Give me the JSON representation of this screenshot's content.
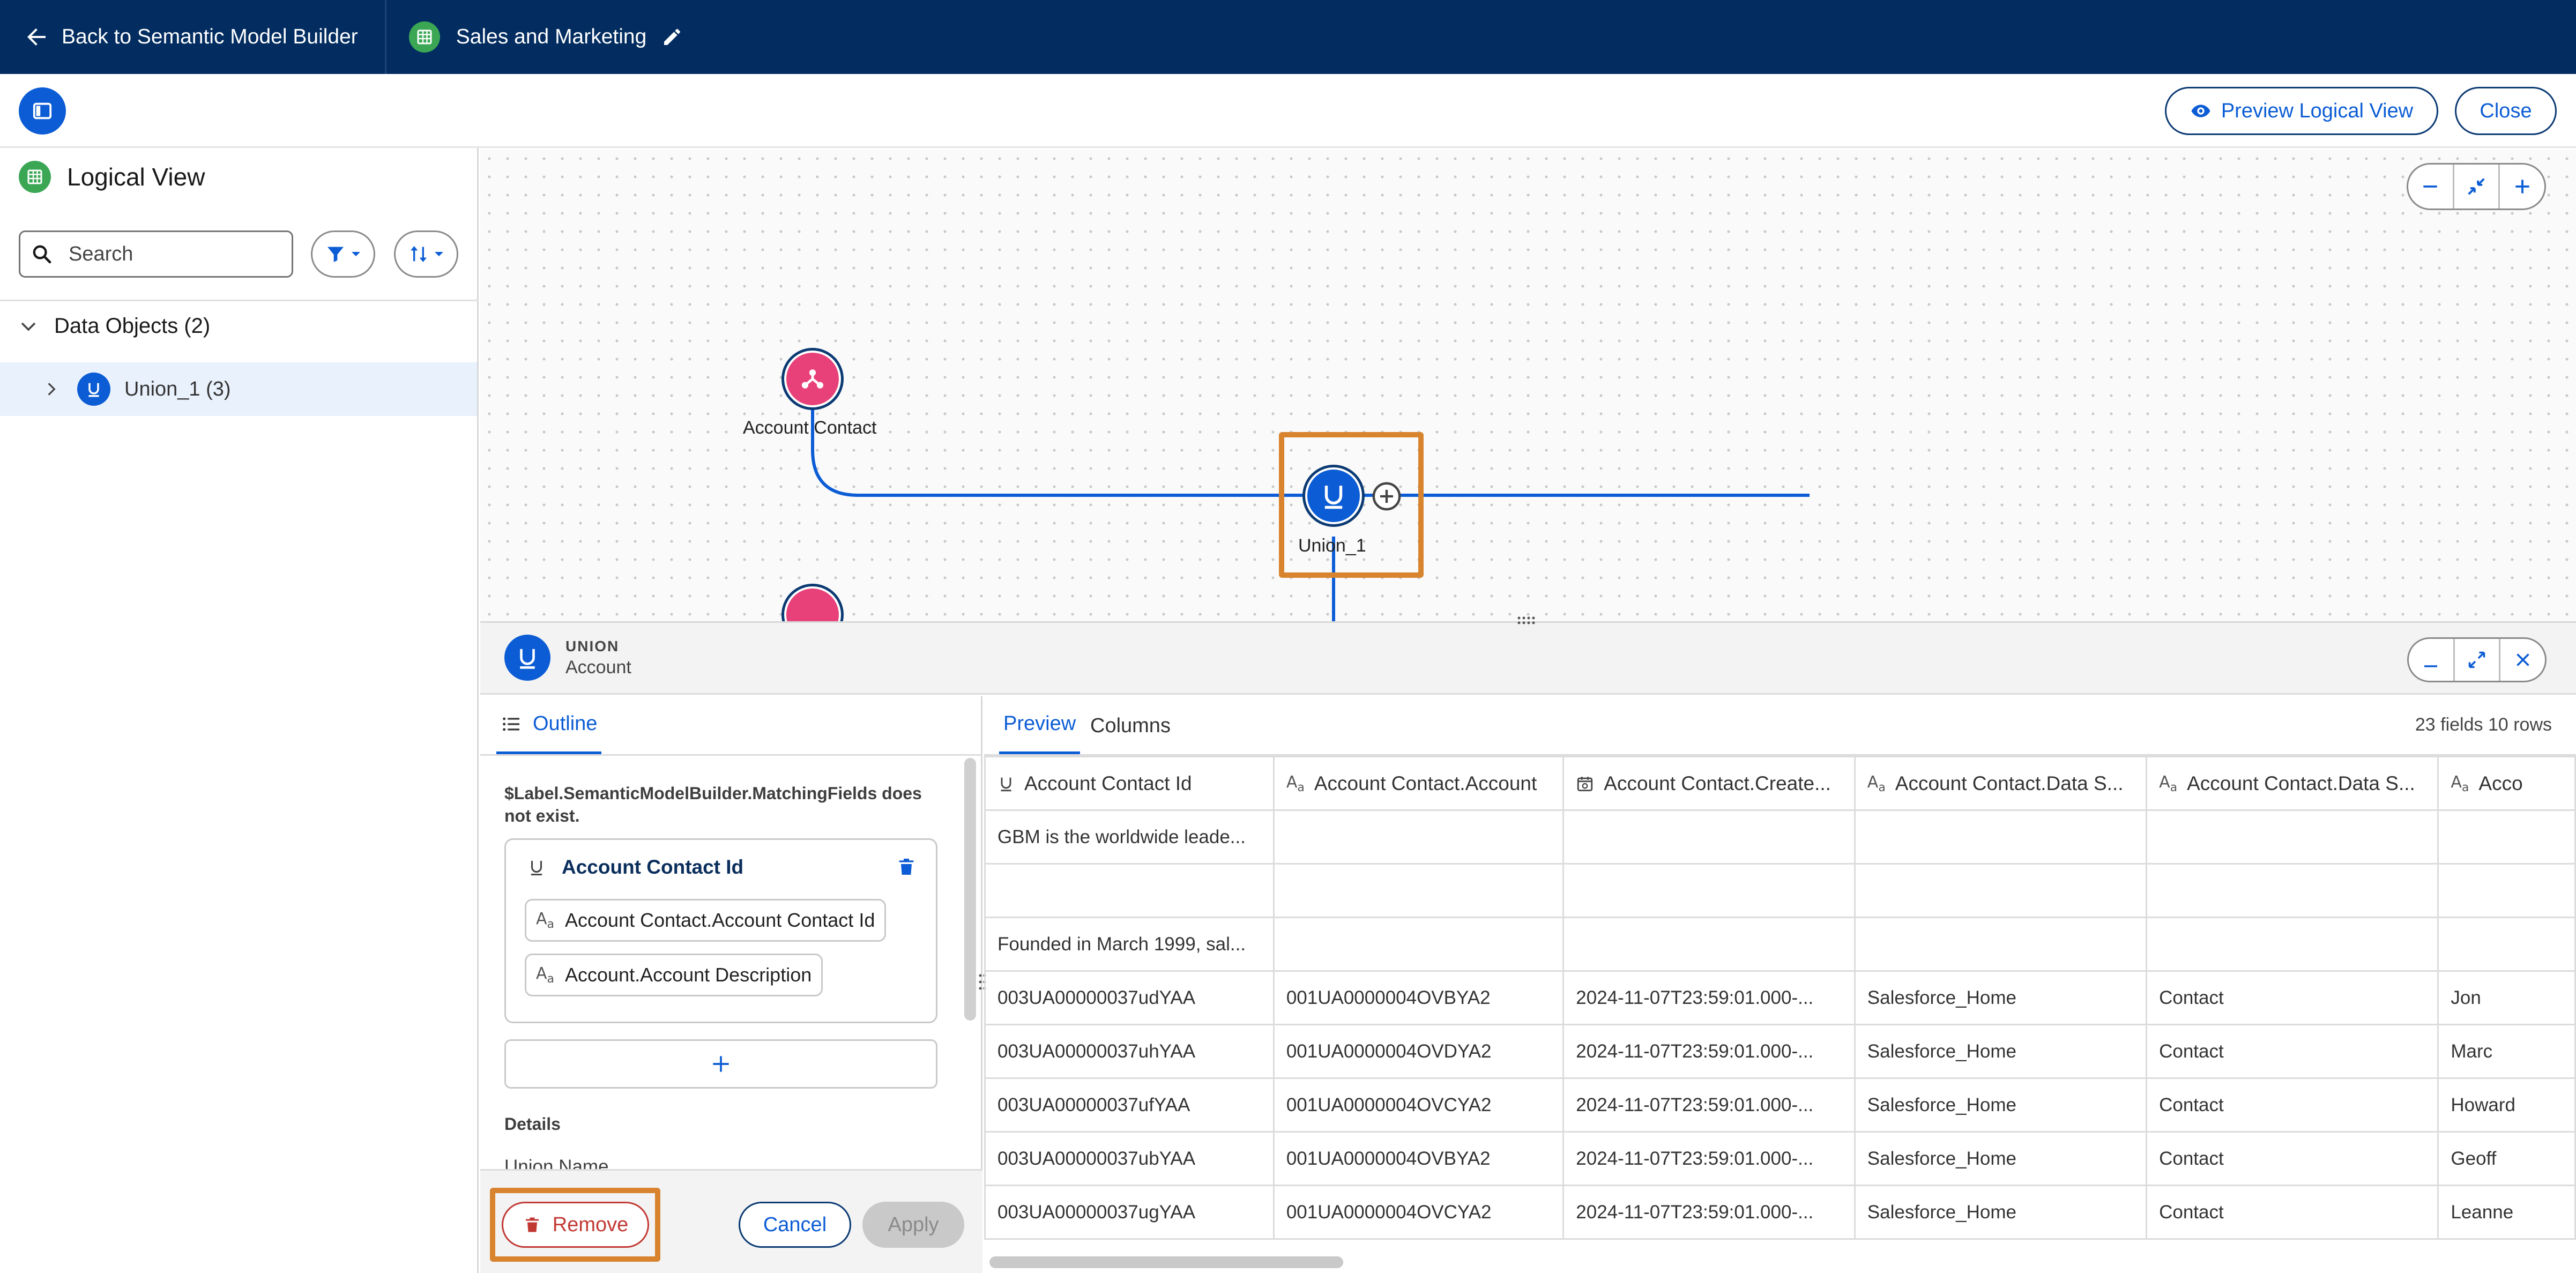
{
  "topbar": {
    "back_label": "Back to Semantic Model Builder",
    "model_name": "Sales and Marketing"
  },
  "header": {
    "preview_label": "Preview Logical View",
    "close_label": "Close"
  },
  "left_panel": {
    "title": "Logical View",
    "search_placeholder": "Search",
    "tree_header": "Data Objects (2)",
    "tree_item": "Union_1 (3)"
  },
  "canvas": {
    "nodes": [
      {
        "label": "Account Contact"
      },
      {
        "label": "Union_1"
      }
    ]
  },
  "bottom_panel": {
    "type_label": "UNION",
    "object_name": "Account"
  },
  "outline": {
    "tab_label": "Outline",
    "warning": "$Label.SemanticModelBuilder.MatchingFields does not exist.",
    "match_title": "Account Contact Id",
    "fields": [
      "Account Contact.Account Contact Id",
      "Account.Account Description"
    ],
    "details_label": "Details",
    "union_name_label": "Union Name",
    "remove_label": "Remove",
    "cancel_label": "Cancel",
    "apply_label": "Apply"
  },
  "preview": {
    "tabs": [
      "Preview",
      "Columns"
    ],
    "row_count": "23 fields 10 rows",
    "columns": [
      {
        "label": "Account Contact Id",
        "icon": "union-icon"
      },
      {
        "label": "Account Contact.Account",
        "icon": "text-icon"
      },
      {
        "label": "Account Contact.Create...",
        "icon": "datetime-icon"
      },
      {
        "label": "Account Contact.Data S...",
        "icon": "text-icon"
      },
      {
        "label": "Account Contact.Data S...",
        "icon": "text-icon"
      },
      {
        "label": "Acco",
        "icon": "text-icon"
      }
    ],
    "rows": [
      [
        "GBM is the worldwide leade...",
        "",
        "",
        "",
        "",
        ""
      ],
      [
        "",
        "",
        "",
        "",
        "",
        ""
      ],
      [
        "Founded in March 1999, sal...",
        "",
        "",
        "",
        "",
        ""
      ],
      [
        "003UA00000037udYAA",
        "001UA0000004OVBYA2",
        "2024-11-07T23:59:01.000-...",
        "Salesforce_Home",
        "Contact",
        "Jon"
      ],
      [
        "003UA00000037uhYAA",
        "001UA0000004OVDYA2",
        "2024-11-07T23:59:01.000-...",
        "Salesforce_Home",
        "Contact",
        "Marc"
      ],
      [
        "003UA00000037ufYAA",
        "001UA0000004OVCYA2",
        "2024-11-07T23:59:01.000-...",
        "Salesforce_Home",
        "Contact",
        "Howard"
      ],
      [
        "003UA00000037ubYAA",
        "001UA0000004OVBYA2",
        "2024-11-07T23:59:01.000-...",
        "Salesforce_Home",
        "Contact",
        "Geoff"
      ],
      [
        "003UA00000037ugYAA",
        "001UA0000004OVCYA2",
        "2024-11-07T23:59:01.000-...",
        "Salesforce_Home",
        "Contact",
        "Leanne"
      ]
    ]
  },
  "colors": {
    "topbar": "#032d60",
    "brand_blue": "#0b5cd5",
    "highlight": "#d8842f",
    "remove": "#c23934",
    "node_pink": "#e8417a"
  }
}
